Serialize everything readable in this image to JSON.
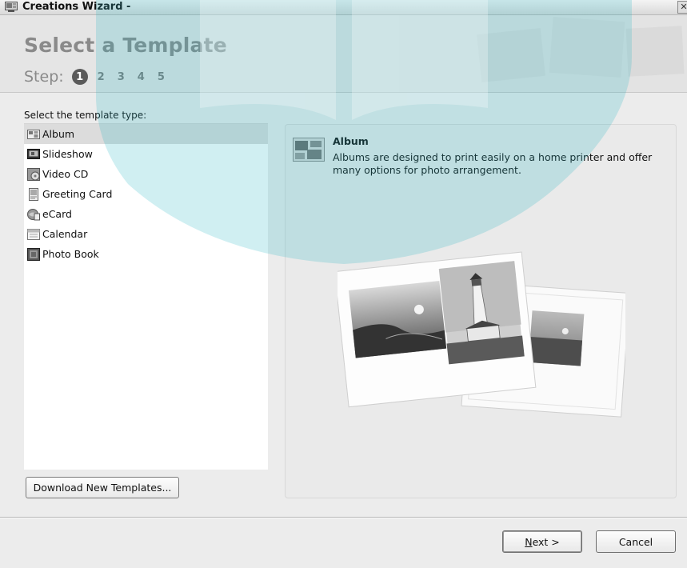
{
  "window": {
    "title": "Creations Wizard -",
    "close_glyph": "✕"
  },
  "header": {
    "title": "Select a Template",
    "step_label": "Step:",
    "current_step": "1",
    "steps": [
      "2",
      "3",
      "4",
      "5"
    ]
  },
  "left": {
    "list_label": "Select the template type:",
    "items": [
      {
        "label": "Album",
        "icon": "album-icon",
        "selected": true
      },
      {
        "label": "Slideshow",
        "icon": "slideshow-icon",
        "selected": false
      },
      {
        "label": "Video CD",
        "icon": "video-cd-icon",
        "selected": false
      },
      {
        "label": "Greeting Card",
        "icon": "greeting-card-icon",
        "selected": false
      },
      {
        "label": "eCard",
        "icon": "ecard-icon",
        "selected": false
      },
      {
        "label": "Calendar",
        "icon": "calendar-icon",
        "selected": false
      },
      {
        "label": "Photo Book",
        "icon": "photo-book-icon",
        "selected": false
      }
    ],
    "download_button": "Download New Templates..."
  },
  "preview": {
    "title": "Album",
    "description": "Albums are designed to print easily on a home printer and offer many options for photo arrangement."
  },
  "footer": {
    "next_mnemonic": "N",
    "next_rest": "ext >",
    "cancel": "Cancel"
  },
  "colors": {
    "accent_teal": "#2ab6c4",
    "selection": "#dcdcdc",
    "header_text": "#8a8a8a"
  }
}
